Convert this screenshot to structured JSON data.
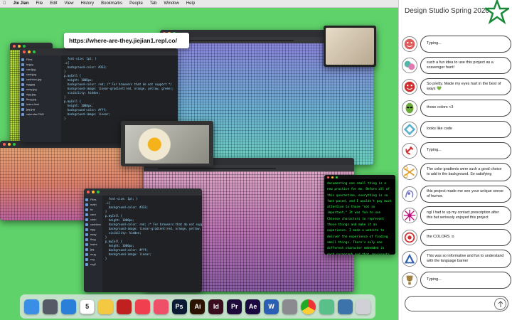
{
  "menubar": {
    "user": "Jie Jian",
    "items": [
      "File",
      "Edit",
      "View",
      "History",
      "Bookmarks",
      "People",
      "Tab",
      "Window",
      "Help"
    ]
  },
  "popup_url": "https://where-are-they.jiejian1.repl.co/",
  "terminal_text": "documenting one small thing is a new practice for me. Before all of this quarantine, everything is so fast-paced, and I wouldn't pay much attention to those \"not so important.\" It was fun to use Chinese characters to represent those things and make it an experience. I made a website to deliver the experience of finding small things. There's only one different character embedded in each paragraph and that represents the small thing that I noticed during the isolation.",
  "panel": {
    "title": "Design Studio Spring 2020",
    "messages": [
      {
        "text": "Typing...",
        "avatar": "face-icon",
        "color": "#e05a5a"
      },
      {
        "text": "such a fun idea to use this project as a scavenger hunt!",
        "avatar": "bubbles-icon",
        "color": "#4fb8a8"
      },
      {
        "text": "So pretty. Made my eyes hurt in the best of ways 💚",
        "avatar": "face-icon",
        "color": "#d03030"
      },
      {
        "text": "those colors <3",
        "avatar": "alien-icon",
        "color": "#6aaa3a"
      },
      {
        "text": "looks like code",
        "avatar": "diamond-icon",
        "color": "#5ab0d0"
      },
      {
        "text": "Typing...",
        "avatar": "hammer-icon",
        "color": "#d03030"
      },
      {
        "text": "The color gradients were such a good choice to add in the background. So satisfying",
        "avatar": "scissors-icon",
        "color": "#e0a030"
      },
      {
        "text": "this project made me see your unique sense of humor.",
        "avatar": "sketch-icon",
        "color": "#7070c0"
      },
      {
        "text": "ngl I had to up my contact prescription after this but seriously enjoyed this project",
        "avatar": "starburst-icon",
        "color": "#c01080"
      },
      {
        "text": "the COLORS :o",
        "avatar": "circle-icon",
        "color": "#d03030"
      },
      {
        "text": "This was so informative and fun to understand with the language barrier",
        "avatar": "triangle-icon",
        "color": "#3060b0"
      },
      {
        "text": "Typing...",
        "avatar": "trophy-icon",
        "color": "#a08040"
      }
    ]
  },
  "dock": [
    {
      "name": "finder",
      "label": "",
      "color": "#3a8ee6"
    },
    {
      "name": "launchpad",
      "label": "",
      "color": "#555a66"
    },
    {
      "name": "safari",
      "label": "",
      "color": "#2a7fd8"
    },
    {
      "name": "calendar",
      "label": "5",
      "color": "#ffffff"
    },
    {
      "name": "notes",
      "label": "",
      "color": "#f5c842"
    },
    {
      "name": "photo-booth",
      "label": "",
      "color": "#c02020"
    },
    {
      "name": "news",
      "label": "",
      "color": "#f04050"
    },
    {
      "name": "music",
      "label": "",
      "color": "#f04f6a"
    },
    {
      "name": "photoshop",
      "label": "Ps",
      "color": "#0b1a33"
    },
    {
      "name": "illustrator",
      "label": "Ai",
      "color": "#2b1300"
    },
    {
      "name": "indesign",
      "label": "Id",
      "color": "#3a0d1e"
    },
    {
      "name": "premiere",
      "label": "Pr",
      "color": "#1d0a3a"
    },
    {
      "name": "after-effects",
      "label": "Ae",
      "color": "#1a0a40"
    },
    {
      "name": "word",
      "label": "W",
      "color": "#2b5fb4"
    },
    {
      "name": "system-preferences",
      "label": "",
      "color": "#8a8a90"
    },
    {
      "name": "chrome",
      "label": "",
      "color": "#ffffff"
    },
    {
      "name": "atom",
      "label": "",
      "color": "#5ac08a"
    },
    {
      "name": "python",
      "label": "",
      "color": "#3b73aa"
    },
    {
      "name": "utility",
      "label": "",
      "color": "#d0d0d6"
    }
  ],
  "code_lines": [
    "  font-size: 1pt; }",
    ".c{",
    "  background-color: #333;",
    "}",
    "p.myCell {",
    "  height: 1000px;",
    "  background-color: red; /* For browsers that do not support */",
    "  background-image: linear-gradient(red, orange, yellow, green);",
    "  visibility: hidden;",
    "}",
    "p.myCell {",
    "  height: 1000px;",
    "  background-color: #fff;",
    "  background-image: linear;",
    "}"
  ]
}
